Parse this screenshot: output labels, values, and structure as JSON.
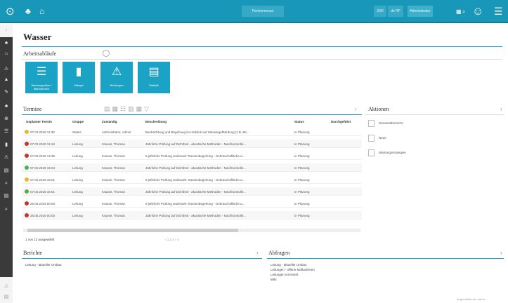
{
  "header": {
    "back_icon": "back-arrow-icon",
    "group_icon": "people-icon",
    "filter_icon": "building-icon",
    "center_button": "Parteimensan",
    "btn_a": "SWI",
    "btn_b": "de RF",
    "btn_c": "Administrator",
    "right_icons": [
      "grid-icon",
      "search-icon",
      "user-icon",
      "menu-icon"
    ]
  },
  "page": {
    "title": "Wasser"
  },
  "workflows": {
    "title": "Arbeitsabläufe",
    "tiles": [
      {
        "label": "Wartungspläne / Maßnahmen",
        "icon": "clipboard-icon",
        "glyph": "☰"
      },
      {
        "label": "Mängel",
        "icon": "book-icon",
        "glyph": "▮"
      },
      {
        "label": "Meldungen",
        "icon": "warning-icon",
        "glyph": "⚠"
      },
      {
        "label": "Statistik",
        "icon": "document-icon",
        "glyph": "▤"
      }
    ]
  },
  "termine": {
    "title": "Termine",
    "toolbar_icons": [
      "list-icon",
      "calendar-icon",
      "table-icon",
      "grid-icon",
      "columns-icon",
      "filter-icon"
    ],
    "columns": [
      "Geplanter Termin",
      "Gruppe",
      "Zuständig",
      "Beschreibung",
      "Status",
      "Durchgeführt"
    ],
    "rows": [
      {
        "status_color": "#e8b830",
        "date": "07.02.2019 11:38",
        "group": "Status",
        "resp": "Administrator, Admin",
        "desc": "Beobachtung und Begehung im Hinblick auf Wassergefährdung (z.B. Be...",
        "status": "In Planung"
      },
      {
        "status_color": "#c0392b",
        "date": "07.02.2019 11:18",
        "group": "Leitung",
        "resp": "Krause, Thomas",
        "desc": "Jährliche Prüfung auf Dichtheit - akustische Methoden - Nachkontrolle...",
        "status": "In Planung"
      },
      {
        "status_color": "#c0392b",
        "date": "07.02.2019 14:35",
        "group": "Leitung",
        "resp": "Krause, Thomas",
        "desc": "5-jährliche Prüfung anderweit Trassenbegehung - Gebrauchsfläche a...",
        "status": "In Planung"
      },
      {
        "status_color": "#4caf50",
        "date": "07.02.2019 15:04",
        "group": "Leitung",
        "resp": "Krause, Thomas",
        "desc": "Jährliche Prüfung auf Dichtheit - akustische Methoden - Nachkontrolle...",
        "status": "In Planung"
      },
      {
        "status_color": "#e8b830",
        "date": "07.02.2019 15:01",
        "group": "Leitung",
        "resp": "Krause, Thomas",
        "desc": "5-jährliche Prüfung anderweit Trassenbegehung - Gebrauchsfläche a...",
        "status": "In Planung"
      },
      {
        "status_color": "#4caf50",
        "date": "07.02.2019 15:01",
        "group": "Leitung",
        "resp": "Krause, Thomas",
        "desc": "Jährliche Prüfung auf Dichtheit - akustische Methoden - Nachkontrolle...",
        "status": "In Planung"
      },
      {
        "status_color": "#c0392b",
        "date": "26.06.2019 00:00",
        "group": "Leitung",
        "resp": "Krause, Thomas",
        "desc": "5-jährliche Prüfung anderweit Trassenbegehung - Gebrauchsfläche a...",
        "status": "In Planung"
      },
      {
        "status_color": "#c0392b",
        "date": "26.06.2019 00:00",
        "group": "Leitung",
        "resp": "Krause, Thomas",
        "desc": "Jährliche Prüfung auf Dichtheit - akustische Methoden - Nachkontrolle...",
        "status": "In Planung"
      }
    ],
    "footer": "1 von 12 ausgewählt",
    "pager": "‹  1  2  3  ›  ›|"
  },
  "aktionen": {
    "title": "Aktionen",
    "items": [
      "Gesamtübersicht",
      "Neue",
      "Wartungsstrategien"
    ]
  },
  "berichte": {
    "title": "Berichte",
    "items": [
      "Leitung - aktueller Umbau"
    ]
  },
  "abfragen": {
    "title": "Abfragen",
    "items": [
      "Leitung - aktueller Umbau",
      "Leitungen - offene Maßnahmen",
      "Leitungen mit Insert",
      "Wiki"
    ]
  },
  "footer_note": "Angemeldet als: admin"
}
